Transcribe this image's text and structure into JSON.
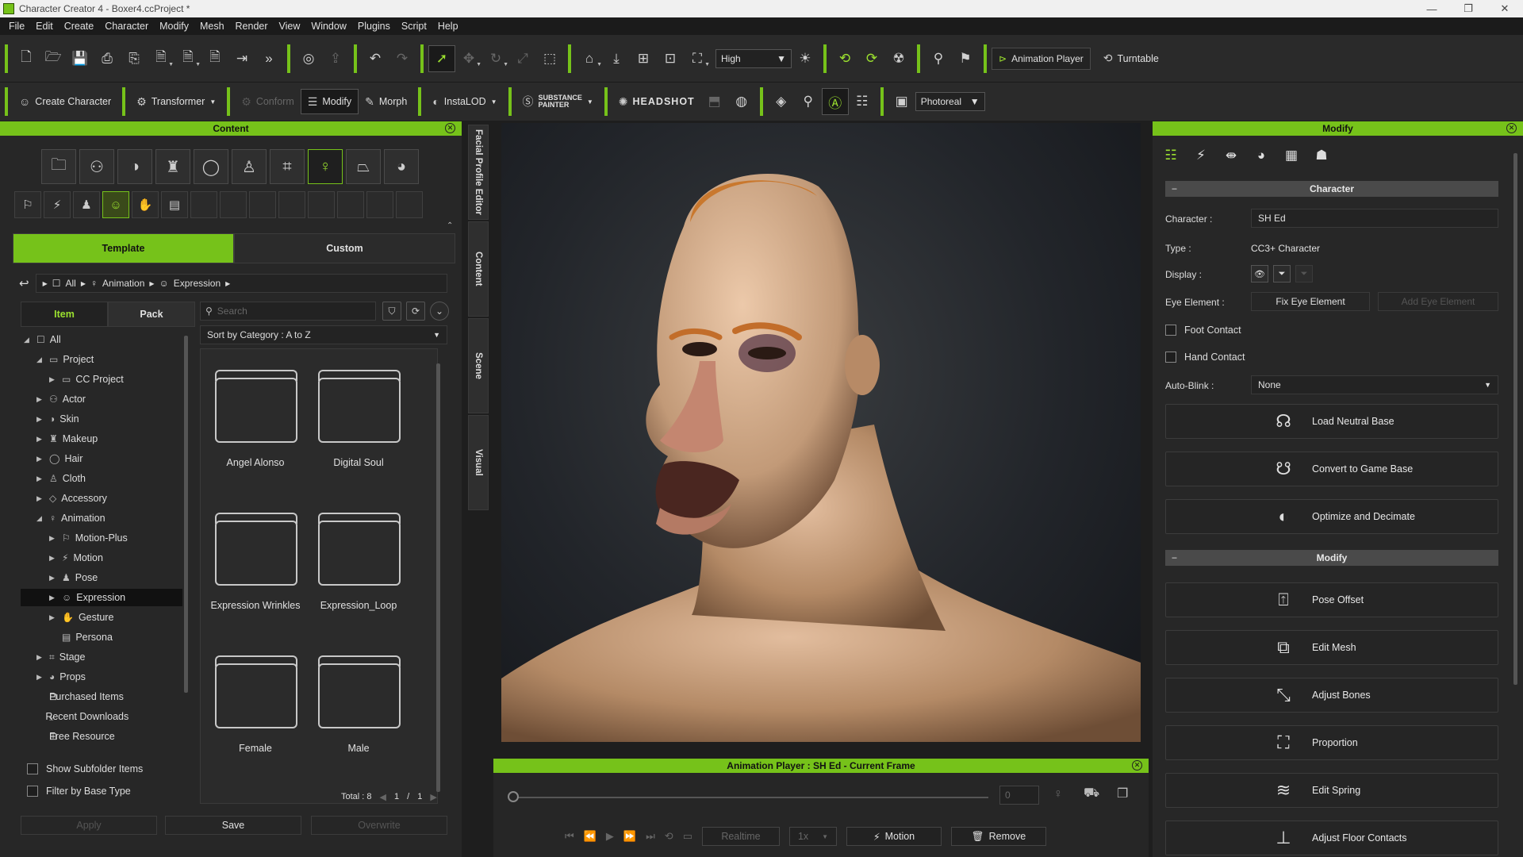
{
  "window": {
    "title": "Character Creator 4 - Boxer4.ccProject *",
    "controls": [
      "—",
      "❐",
      "✕"
    ]
  },
  "menu": [
    "File",
    "Edit",
    "Create",
    "Character",
    "Modify",
    "Mesh",
    "Render",
    "View",
    "Window",
    "Plugins",
    "Script",
    "Help"
  ],
  "toolbar1": {
    "quality_value": "High",
    "animation_player_label": "Animation Player",
    "turntable_label": "Turntable"
  },
  "toolbar2": {
    "create_character": "Create Character",
    "transformer": "Transformer",
    "conform": "Conform",
    "modify": "Modify",
    "morph": "Morph",
    "instalod": "InstaLOD",
    "substance": "SUBSTANCE",
    "substance_sub": "PAINTER",
    "headshot": "HEADSHOT",
    "render_mode": "Photoreal"
  },
  "content_panel": {
    "title": "Content",
    "tabs": [
      "Template",
      "Custom"
    ],
    "breadcrumb": [
      "All",
      "Animation",
      "Expression"
    ],
    "left_tabs": [
      "Item",
      "Pack"
    ],
    "search_placeholder": "Search",
    "sort_label": "Sort by Category : A to Z",
    "tree": [
      {
        "label": "All"
      },
      {
        "label": "Project"
      },
      {
        "label": "CC Project"
      },
      {
        "label": "Actor"
      },
      {
        "label": "Skin"
      },
      {
        "label": "Makeup"
      },
      {
        "label": "Hair"
      },
      {
        "label": "Cloth"
      },
      {
        "label": "Accessory"
      },
      {
        "label": "Animation"
      },
      {
        "label": "Motion-Plus"
      },
      {
        "label": "Motion"
      },
      {
        "label": "Pose"
      },
      {
        "label": "Expression"
      },
      {
        "label": "Gesture"
      },
      {
        "label": "Persona"
      },
      {
        "label": "Stage"
      },
      {
        "label": "Props"
      },
      {
        "label": "Purchased Items"
      },
      {
        "label": "Recent Downloads"
      },
      {
        "label": "Free Resource"
      }
    ],
    "folders": [
      "Angel Alonso",
      "Digital Soul",
      "Expression Wrinkles",
      "Expression_Loop",
      "Female",
      "Male"
    ],
    "show_subfolder": "Show Subfolder Items",
    "filter_base": "Filter by Base Type",
    "total": "Total : 8",
    "page_current": "1",
    "page_sep": "/",
    "page_total": "1",
    "apply": "Apply",
    "save": "Save",
    "overwrite": "Overwrite"
  },
  "side_tabs": [
    "Facial Profile Editor",
    "Content",
    "Scene",
    "Visual"
  ],
  "anim_player": {
    "title": "Animation Player : SH Ed - Current Frame",
    "frame": "0",
    "realtime": "Realtime",
    "speed": "1x",
    "motion": "Motion",
    "remove": "Remove"
  },
  "modify_panel": {
    "title": "Modify",
    "character_section": "Character",
    "character_label": "Character :",
    "character_value": "SH Ed",
    "type_label": "Type :",
    "type_value": "CC3+ Character",
    "display_label": "Display :",
    "eye_label": "Eye Element :",
    "fix_eye": "Fix Eye Element",
    "add_eye": "Add Eye Element",
    "foot_contact": "Foot Contact",
    "hand_contact": "Hand Contact",
    "autoblink_label": "Auto-Blink :",
    "autoblink_value": "None",
    "load_neutral": "Load Neutral Base",
    "convert_game": "Convert to Game Base",
    "optimize": "Optimize and Decimate",
    "modify_section": "Modify",
    "pose_offset": "Pose Offset",
    "edit_mesh": "Edit Mesh",
    "adjust_bones": "Adjust Bones",
    "proportion": "Proportion",
    "edit_spring": "Edit Spring",
    "adjust_floor": "Adjust Floor Contacts"
  },
  "colors": {
    "accent": "#76c21a",
    "panel_bg": "#272727"
  }
}
